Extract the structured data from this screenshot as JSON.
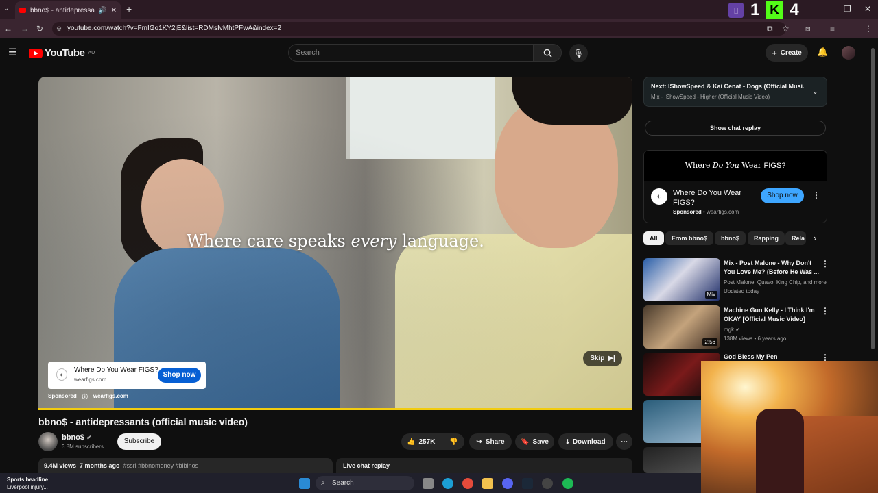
{
  "browser": {
    "tab_title": "bbno$ - antidepressants (o",
    "url": "youtube.com/watch?v=FmIGo1KY2jE&list=RDMsIvMhtPFwA&index=2"
  },
  "youtube": {
    "logo_text": "YouTube",
    "region": "AU",
    "search_placeholder": "Search",
    "create_label": "Create"
  },
  "video": {
    "ad_caption_pre": "Where care speaks ",
    "ad_caption_em": "every",
    "ad_caption_post": " language.",
    "skip_label": "Skip",
    "ad_card_title": "Where Do You Wear FIGS?",
    "ad_card_domain": "wearfigs.com",
    "ad_card_button": "Shop now",
    "ad_sponsored": "Sponsored",
    "ad_domain": "wearfigs.com",
    "ad_progress_fraction": 1.0
  },
  "meta": {
    "title": "bbno$ - antidepressants (official music video)",
    "channel": "bbno$",
    "subscribers": "3.8M subscribers",
    "subscribe_label": "Subscribe",
    "likes": "257K",
    "share_label": "Share",
    "save_label": "Save",
    "download_label": "Download",
    "views": "9.4M views",
    "age": "7 months ago",
    "tags": "#ssri #bbnomoney #bibinos",
    "live_chat_label": "Live chat replay"
  },
  "sidebar": {
    "up_next_line1": "Next: IShowSpeed & Kai Cenat - Dogs (Official Musi...",
    "up_next_line2": "Mix - IShowSpeed - Higher (Official Music Video)",
    "show_chat_replay": "Show chat replay",
    "sponsor_banner_pre": "Where ",
    "sponsor_banner_em": "Do You",
    "sponsor_banner_post": " Wear",
    "sponsor_banner_brand": "FIGS?",
    "sponsor_title": "Where Do You Wear FIGS?",
    "sponsor_label": "Sponsored",
    "sponsor_domain": "wearfigs.com",
    "sponsor_button": "Shop now",
    "chips": [
      "All",
      "From bbno$",
      "bbno$",
      "Rapping",
      "Rela"
    ],
    "recommendations": [
      {
        "title": "Mix - Post Malone - Why Don't You Love Me? (Before He Was ...",
        "meta1": "Post Malone, Quavo, King Chip, and more",
        "meta2": "Updated today",
        "badge": "Mix"
      },
      {
        "title": "Machine Gun Kelly - I Think I'm OKAY [Official Music Video]",
        "meta1": "mgk",
        "meta2": "138M views • 6 years ago",
        "badge": "2:56"
      },
      {
        "title": "God Bless My Pen",
        "meta1": "",
        "meta2": "",
        "badge": ""
      }
    ]
  },
  "overlay": {
    "twitch_count": "1",
    "kick_count": "4"
  },
  "taskbar": {
    "news_headline": "Sports headline",
    "news_sub": "Liverpool injury...",
    "search_label": "Search"
  },
  "colors": {
    "yt_red": "#ff0000",
    "shop_blue": "#065fd4",
    "shop_light_blue": "#3ea6ff",
    "ad_progress": "#f2cc0f",
    "twitch": "#6441a5",
    "kick": "#53fc18"
  }
}
